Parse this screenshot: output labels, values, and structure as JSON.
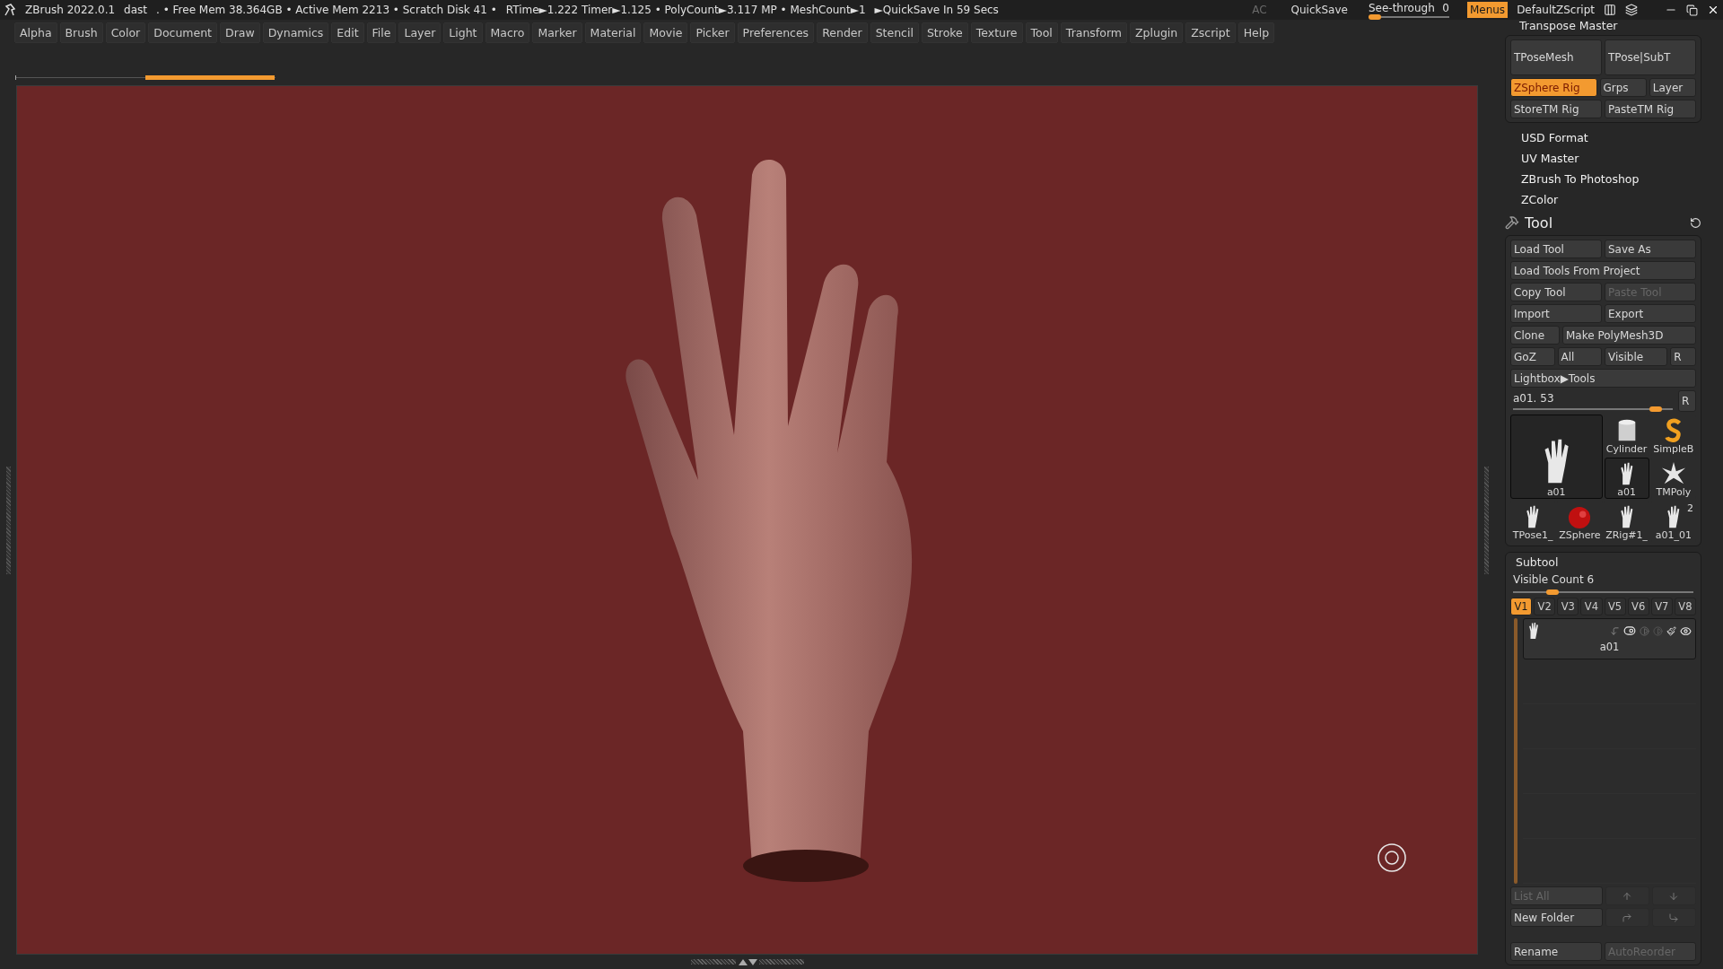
{
  "title_bar": {
    "app": "ZBrush 2022.0.1",
    "file": "dast",
    "stats": [
      ". • Free Mem 38.364GB • Active Mem 2213 • Scratch Disk 41 •",
      "RTime►1.222 Timer►1.125 • PolyCount►3.117 MP • MeshCount►1",
      "►QuickSave In 59 Secs"
    ],
    "ac": "AC",
    "quicksave": "QuickSave",
    "see_through": {
      "label": "See-through",
      "reading": "0",
      "level": 0.08
    },
    "menus": {
      "label": "Menus",
      "on": true
    },
    "script": "DefaultZScript"
  },
  "menu_bar": [
    "Alpha",
    "Brush",
    "Color",
    "Document",
    "Draw",
    "Dynamics",
    "Edit",
    "File",
    "Layer",
    "Light",
    "Macro",
    "Marker",
    "Material",
    "Movie",
    "Picker",
    "Preferences",
    "Render",
    "Stencil",
    "Stroke",
    "Texture",
    "Tool",
    "Transform",
    "Zplugin",
    "Zscript",
    "Help"
  ],
  "transpose_master": {
    "title": "Transpose Master",
    "rows": [
      [
        {
          "label": "TPoseMesh",
          "kind": "wide",
          "selected": false
        },
        {
          "label": "TPose|SubT",
          "kind": "wide",
          "selected": false
        }
      ],
      [
        {
          "label": "ZSphere Rig",
          "kind": "wide",
          "selected": true
        },
        {
          "label": "Grps",
          "kind": "narrow",
          "selected": false
        },
        {
          "label": "Layer",
          "kind": "narrow",
          "selected": false
        }
      ],
      [
        {
          "label": "StoreTM Rig",
          "kind": "wide",
          "selected": false
        },
        {
          "label": "PasteTM Rig",
          "kind": "wide",
          "selected": false
        }
      ]
    ]
  },
  "plugins": [
    "USD Format",
    "UV Master",
    "ZBrush To Photoshop",
    "ZColor"
  ],
  "tool": {
    "title": "Tool",
    "rows": [
      [
        {
          "label": "Load Tool",
          "kind": "wide",
          "disabled": false
        },
        {
          "label": "Save As",
          "kind": "wide",
          "disabled": false
        }
      ],
      [
        {
          "label": "Load Tools From Project",
          "kind": "full",
          "disabled": false
        }
      ],
      [
        {
          "label": "Copy Tool",
          "kind": "wide",
          "disabled": false
        },
        {
          "label": "Paste Tool",
          "kind": "wide",
          "disabled": true
        }
      ],
      [
        {
          "label": "Import",
          "kind": "wide",
          "disabled": false
        },
        {
          "label": "Export",
          "kind": "wide",
          "disabled": false
        }
      ],
      [
        {
          "label": "Clone",
          "kind": "narrow",
          "disabled": false
        },
        {
          "label": "Make PolyMesh3D",
          "kind": "long",
          "disabled": false
        }
      ],
      [
        {
          "label": "GoZ",
          "kind": "narrow",
          "disabled": false
        },
        {
          "label": "All",
          "kind": "narrow",
          "disabled": false
        },
        {
          "label": "Visible",
          "kind": "medium",
          "disabled": false
        },
        {
          "label": "R",
          "kind": "tiny",
          "disabled": false
        }
      ],
      [
        {
          "label": "Lightbox▶Tools",
          "kind": "full",
          "disabled": false
        }
      ]
    ],
    "slider": {
      "label": "a01. 53",
      "level": 0.93,
      "reset": "R"
    },
    "thumbnails": [
      {
        "label": "a01",
        "kind": "hand",
        "selected": true
      },
      {
        "label": "Cylinder",
        "kind": "cylinder",
        "selected": false
      },
      {
        "label": "SimpleB",
        "kind": "snake",
        "selected": false
      },
      {
        "label": "a01",
        "kind": "hand",
        "selected": true
      },
      {
        "label": "TMPoly",
        "kind": "star",
        "selected": false
      },
      {
        "label": "TPose1_",
        "kind": "hand",
        "selected": false
      },
      {
        "label": "ZSphere",
        "kind": "sphere",
        "selected": false
      },
      {
        "label": "ZRig#1_",
        "kind": "hand",
        "selected": false
      },
      {
        "label": "a01_01",
        "kind": "hand",
        "selected": false,
        "badge": "2"
      }
    ]
  },
  "subtool": {
    "title": "Subtool",
    "visible_count": {
      "label": "Visible Count 6",
      "level": 0.22
    },
    "versions": [
      {
        "label": "V1",
        "selected": true
      },
      {
        "label": "V2",
        "selected": false
      },
      {
        "label": "V3",
        "selected": false
      },
      {
        "label": "V4",
        "selected": false
      },
      {
        "label": "V5",
        "selected": false
      },
      {
        "label": "V6",
        "selected": false
      },
      {
        "label": "V7",
        "selected": false
      },
      {
        "label": "V8",
        "selected": false
      }
    ],
    "items": [
      {
        "name": "a01"
      }
    ],
    "list_all": {
      "label": "List All",
      "disabled": true
    },
    "new_folder": {
      "label": "New Folder",
      "disabled": false
    },
    "rename": {
      "label": "Rename",
      "disabled": false
    },
    "auto_reorder": {
      "label": "AutoReorder",
      "disabled": true
    }
  }
}
